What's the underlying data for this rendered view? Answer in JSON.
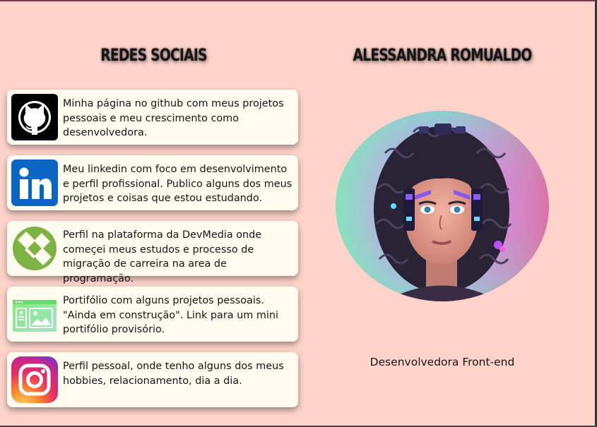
{
  "social": {
    "heading": "Redes Sociais",
    "cards": [
      {
        "icon": "github-icon",
        "text": "Minha página no github com meus projetos pessoais e meu crescimento como desenvolvedora."
      },
      {
        "icon": "linkedin-icon",
        "text": "Meu linkedin com foco em desenvolvimento e perfil profissional. Publico alguns dos meus projetos e coisas que estou estudando."
      },
      {
        "icon": "devmedia-icon",
        "text": "Perfil na plataforma da DevMedia onde começei meus estudos e processo de migração de carreira na area de programação."
      },
      {
        "icon": "portfolio-icon",
        "text": "Portifólio com alguns projetos pessoais. \"Ainda em construção\". Link para um mini portifólio provisório."
      },
      {
        "icon": "instagram-icon",
        "text": "Perfil pessoal, onde tenho alguns dos meus hobbies, relacionamento, dia a dia."
      }
    ]
  },
  "profile": {
    "name": "Alessandra Romualdo",
    "role": "Desenvolvedora Front-end"
  },
  "colors": {
    "background": "#fed4ca",
    "card": "#fffbee",
    "text": "#151515",
    "github": "#000000",
    "linkedin": "#0a66c2",
    "devmedia": "#7cb342",
    "portfolio": "#8fe08f"
  }
}
